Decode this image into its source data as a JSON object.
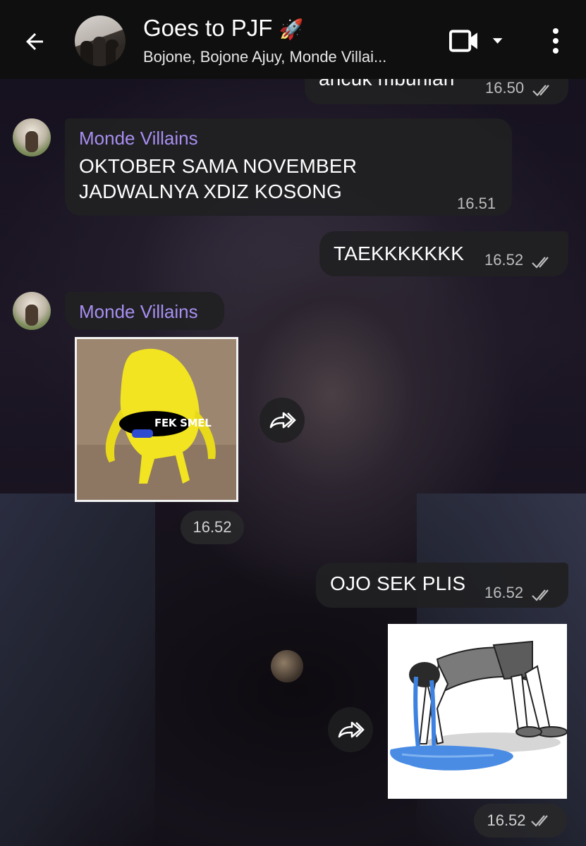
{
  "header": {
    "title": "Goes to PJF",
    "title_emoji": "🚀",
    "subtitle": "Bojone, Bojone Ajuy, Monde Villai..."
  },
  "messages": {
    "m0": {
      "text": "ancuk mbunian",
      "time": "16.50"
    },
    "m1": {
      "sender": "Monde Villains",
      "line1": "OKTOBER SAMA NOVEMBER",
      "line2": "JADWALNYA XDIZ KOSONG",
      "time": "16.51"
    },
    "m2": {
      "text": "TAEKKKKKKK",
      "time": "16.52"
    },
    "m3": {
      "sender": "Monde Villains",
      "sticker_caption": "FEK SMEL",
      "time": "16.52"
    },
    "m4": {
      "text": "OJO SEK PLIS",
      "time": "16.52"
    },
    "m5": {
      "time": "16.52"
    }
  },
  "colors": {
    "topbar": "#0f0f0f",
    "bubble": "#202022",
    "sender_name": "#a78ff0",
    "timestamp": "#bdbdbd"
  },
  "icons": [
    "back-arrow-icon",
    "video-camera-icon",
    "dropdown-triangle-icon",
    "more-vert-icon",
    "double-check-icon",
    "forward-icon"
  ]
}
